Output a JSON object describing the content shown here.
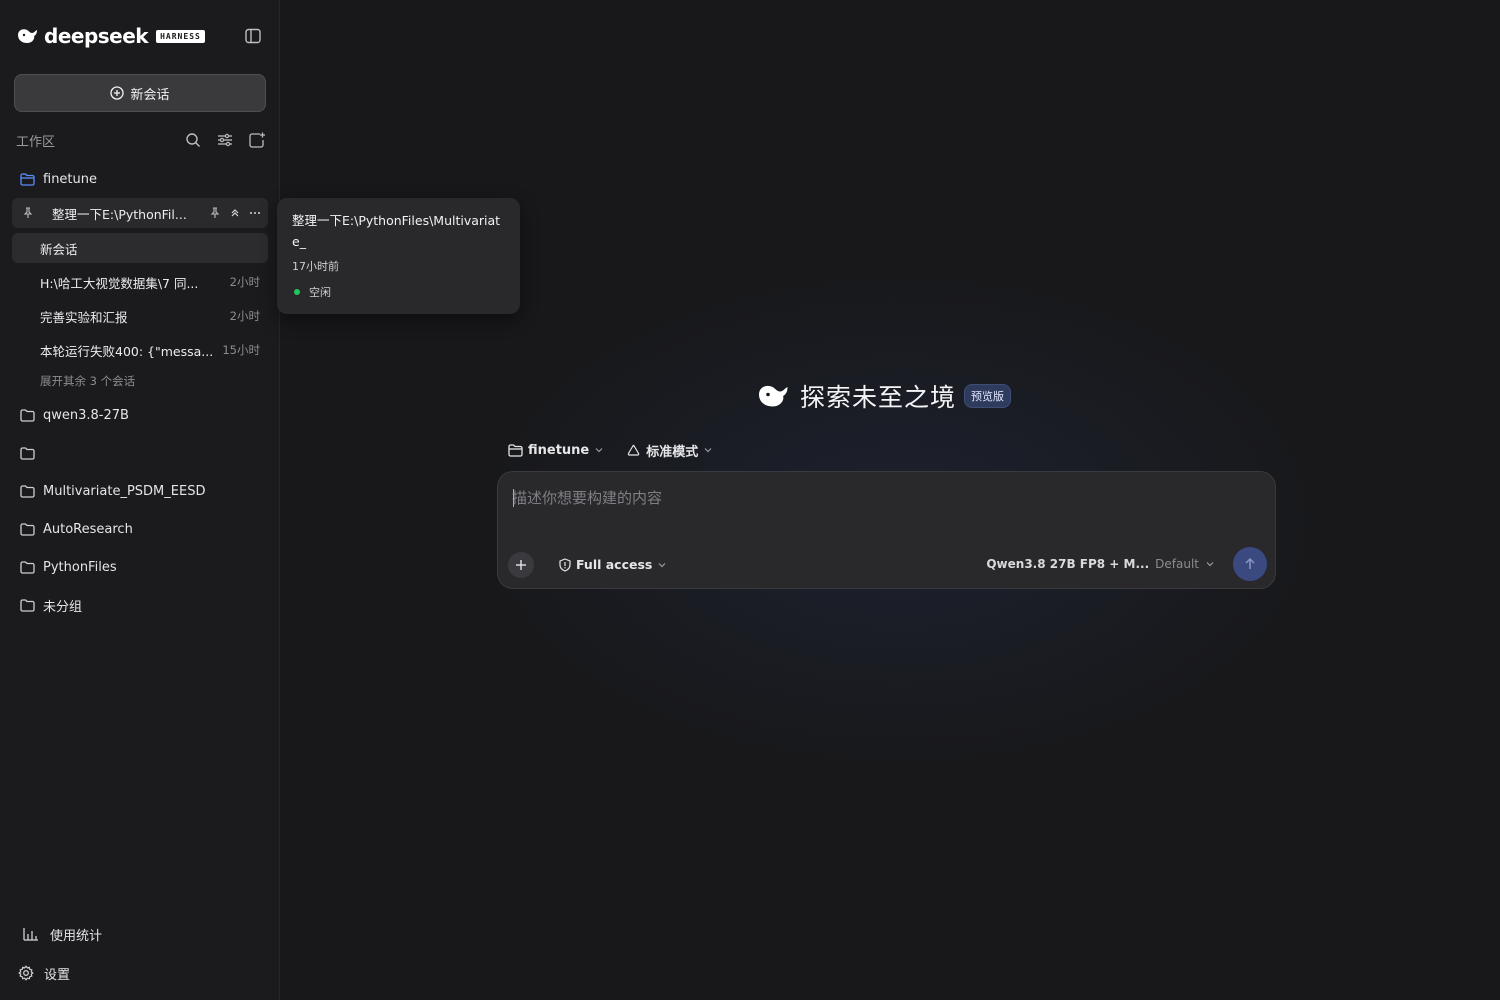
{
  "app": {
    "logo_text": "deepseek",
    "badge": "HARNESS"
  },
  "sidebar": {
    "new_chat_label": "新会话",
    "workspace_label": "工作区",
    "folders": [
      {
        "name": "finetune",
        "active": true
      },
      {
        "name": "qwen3.8-27B"
      },
      {
        "name": ""
      },
      {
        "name": "Multivariate_PSDM_EESD"
      },
      {
        "name": "AutoResearch"
      },
      {
        "name": "PythonFiles"
      },
      {
        "name": "未分组"
      }
    ],
    "pinned_conversation": "整理一下E:\\PythonFil...",
    "conversations": [
      {
        "title": "新会话",
        "time": ""
      },
      {
        "title": "H:\\哈工大视觉数据集\\7 同...",
        "time": "2小时"
      },
      {
        "title": "完善实验和汇报",
        "time": "2小时"
      },
      {
        "title": "本轮运行失败400: {\"messa...",
        "time": "15小时"
      }
    ],
    "expand_more": "展开其余 3 个会话",
    "usage_stats": "使用统计",
    "settings": "设置"
  },
  "tooltip": {
    "title": "整理一下E:\\PythonFiles\\Multivariate_",
    "time": "17小时前",
    "status": "空闲"
  },
  "main": {
    "hero_title": "探索未至之境",
    "preview_badge": "预览版",
    "workspace_selector": "finetune",
    "mode_selector": "标准模式",
    "composer_placeholder": "描述你想要构建的内容",
    "access_label": "Full access",
    "model_name": "Qwen3.8 27B FP8 + M...",
    "model_mode": "Default"
  },
  "colors": {
    "accent": "#3a4a80",
    "status_idle": "#22c55e",
    "folder_active": "#5b8cff"
  }
}
